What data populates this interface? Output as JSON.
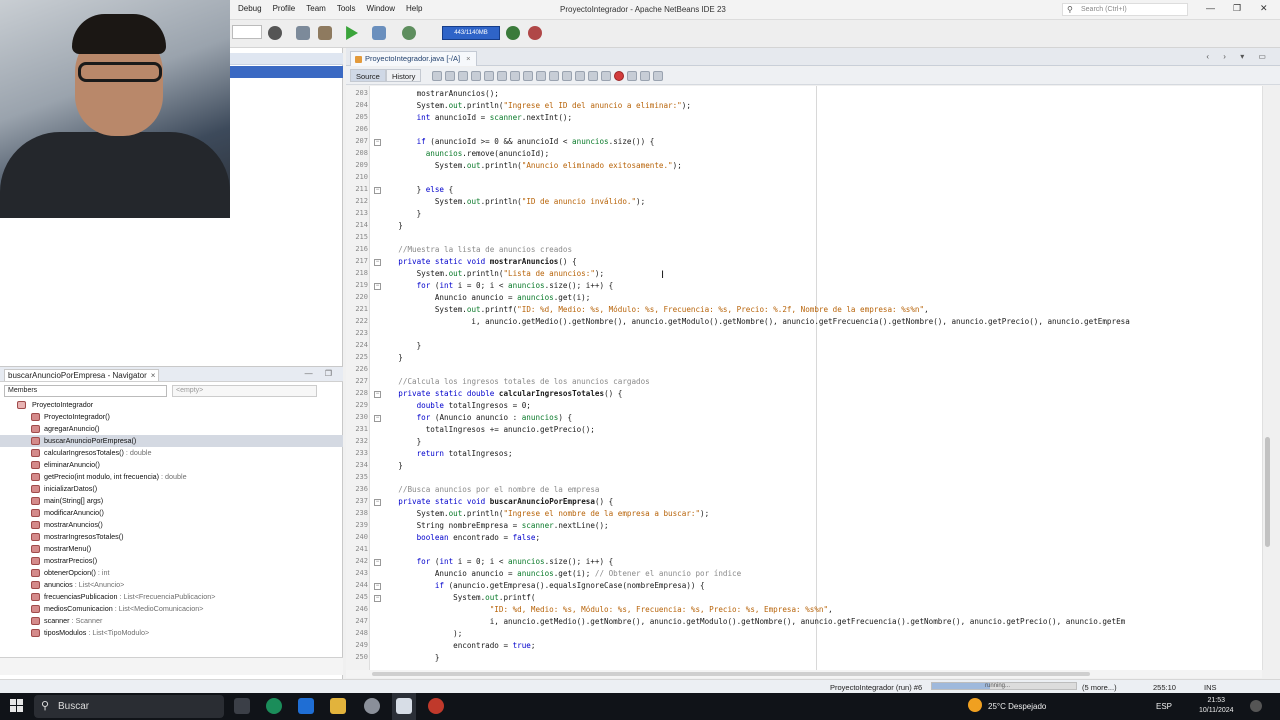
{
  "window": {
    "title": "ProyectoIntegrador - Apache NetBeans IDE 23",
    "search_placeholder": "Search (Ctrl+I)",
    "menu": [
      "Debug",
      "Profile",
      "Team",
      "Tools",
      "Window",
      "Help"
    ],
    "controls": [
      "—",
      "❐",
      "✕"
    ]
  },
  "toolbar": {
    "profile_button": "443/1140MB"
  },
  "editor": {
    "tab_label": "ProyectoIntegrador.java",
    "tab_suffix": "[-/A]",
    "view_source": "Source",
    "view_history": "History"
  },
  "code": {
    "lines": [
      {
        "n": "203",
        "text": "        mostrarAnuncios();"
      },
      {
        "n": "204",
        "text": "        System.out.println(\"Ingrese el ID del anuncio a eliminar:\");"
      },
      {
        "n": "205",
        "text": "        int anuncioId = scanner.nextInt();"
      },
      {
        "n": "206",
        "text": ""
      },
      {
        "n": "207",
        "text": "        if (anuncioId >= 0 && anuncioId < anuncios.size()) {"
      },
      {
        "n": "208",
        "text": "          anuncios.remove(anuncioId);"
      },
      {
        "n": "209",
        "text": "            System.out.println(\"Anuncio eliminado exitosamente.\");"
      },
      {
        "n": "210",
        "text": ""
      },
      {
        "n": "211",
        "text": "        } else {"
      },
      {
        "n": "212",
        "text": "            System.out.println(\"ID de anuncio inválido.\");"
      },
      {
        "n": "213",
        "text": "        }"
      },
      {
        "n": "214",
        "text": "    }"
      },
      {
        "n": "215",
        "text": ""
      },
      {
        "n": "216",
        "text": "    //Muestra la lista de anuncios creados"
      },
      {
        "n": "217",
        "text": "    private static void mostrarAnuncios() {"
      },
      {
        "n": "218",
        "text": "        System.out.println(\"Lista de anuncios:\");"
      },
      {
        "n": "219",
        "text": "        for (int i = 0; i < anuncios.size(); i++) {"
      },
      {
        "n": "220",
        "text": "            Anuncio anuncio = anuncios.get(i);"
      },
      {
        "n": "221",
        "text": "            System.out.printf(\"ID: %d, Medio: %s, Módulo: %s, Frecuencia: %s, Precio: %.2f, Nombre de la empresa: %s%n\","
      },
      {
        "n": "222",
        "text": "                    i, anuncio.getMedio().getNombre(), anuncio.getModulo().getNombre(), anuncio.getFrecuencia().getNombre(), anuncio.getPrecio(), anuncio.getEmpresa"
      },
      {
        "n": "223",
        "text": ""
      },
      {
        "n": "224",
        "text": "        }"
      },
      {
        "n": "225",
        "text": "    }"
      },
      {
        "n": "226",
        "text": ""
      },
      {
        "n": "227",
        "text": "    //Calcula los ingresos totales de los anuncios cargados"
      },
      {
        "n": "228",
        "text": "    private static double calcularIngresosTotales() {"
      },
      {
        "n": "229",
        "text": "        double totalIngresos = 0;"
      },
      {
        "n": "230",
        "text": "        for (Anuncio anuncio : anuncios) {"
      },
      {
        "n": "231",
        "text": "          totalIngresos += anuncio.getPrecio();"
      },
      {
        "n": "232",
        "text": "        }"
      },
      {
        "n": "233",
        "text": "        return totalIngresos;"
      },
      {
        "n": "234",
        "text": "    }"
      },
      {
        "n": "235",
        "text": ""
      },
      {
        "n": "236",
        "text": "    //Busca anuncios por el nombre de la empresa"
      },
      {
        "n": "237",
        "text": "    private static void buscarAnuncioPorEmpresa() {"
      },
      {
        "n": "238",
        "text": "        System.out.println(\"Ingrese el nombre de la empresa a buscar:\");"
      },
      {
        "n": "239",
        "text": "        String nombreEmpresa = scanner.nextLine();"
      },
      {
        "n": "240",
        "text": "        boolean encontrado = false;"
      },
      {
        "n": "241",
        "text": ""
      },
      {
        "n": "242",
        "text": "        for (int i = 0; i < anuncios.size(); i++) {"
      },
      {
        "n": "243",
        "text": "            Anuncio anuncio = anuncios.get(i); // Obtener el anuncio por índice"
      },
      {
        "n": "244",
        "text": "            if (anuncio.getEmpresa().equalsIgnoreCase(nombreEmpresa)) {"
      },
      {
        "n": "245",
        "text": "                System.out.printf("
      },
      {
        "n": "246",
        "text": "                        \"ID: %d, Medio: %s, Módulo: %s, Frecuencia: %s, Precio: %s, Empresa: %s%n\","
      },
      {
        "n": "247",
        "text": "                        i, anuncio.getMedio().getNombre(), anuncio.getModulo().getNombre(), anuncio.getFrecuencia().getNombre(), anuncio.getPrecio(), anuncio.getEm"
      },
      {
        "n": "248",
        "text": "                );"
      },
      {
        "n": "249",
        "text": "                encontrado = true;"
      },
      {
        "n": "250",
        "text": "            }"
      }
    ]
  },
  "navigator": {
    "title": "buscarAnuncioPorEmpresa - Navigator",
    "filter": "Members",
    "filter2": "<empty>",
    "items": [
      {
        "label": "ProyectoIntegrador",
        "type": "",
        "root": true,
        "selected": false
      },
      {
        "label": "ProyectoIntegrador()",
        "type": "",
        "root": false,
        "selected": false
      },
      {
        "label": "agregarAnuncio()",
        "type": "",
        "root": false,
        "selected": false
      },
      {
        "label": "buscarAnuncioPorEmpresa()",
        "type": "",
        "root": false,
        "selected": true
      },
      {
        "label": "calcularIngresosTotales()",
        "type": " : double",
        "root": false,
        "selected": false
      },
      {
        "label": "eliminarAnuncio()",
        "type": "",
        "root": false,
        "selected": false
      },
      {
        "label": "getPrecio(int modulo, int frecuencia)",
        "type": " : double",
        "root": false,
        "selected": false
      },
      {
        "label": "inicializarDatos()",
        "type": "",
        "root": false,
        "selected": false
      },
      {
        "label": "main(String[] args)",
        "type": "",
        "root": false,
        "selected": false
      },
      {
        "label": "modificarAnuncio()",
        "type": "",
        "root": false,
        "selected": false
      },
      {
        "label": "mostrarAnuncios()",
        "type": "",
        "root": false,
        "selected": false
      },
      {
        "label": "mostrarIngresosTotales()",
        "type": "",
        "root": false,
        "selected": false
      },
      {
        "label": "mostrarMenu()",
        "type": "",
        "root": false,
        "selected": false
      },
      {
        "label": "mostrarPrecios()",
        "type": "",
        "root": false,
        "selected": false
      },
      {
        "label": "obtenerOpcion()",
        "type": " : int",
        "root": false,
        "selected": false
      },
      {
        "label": "anuncios",
        "type": " : List<Anuncio>",
        "root": false,
        "selected": false
      },
      {
        "label": "frecuenciasPublicacion",
        "type": " : List<FrecuenciaPublicacion>",
        "root": false,
        "selected": false
      },
      {
        "label": "mediosComunicacion",
        "type": " : List<MedioComunicacion>",
        "root": false,
        "selected": false
      },
      {
        "label": "scanner",
        "type": " : Scanner",
        "root": false,
        "selected": false
      },
      {
        "label": "tiposModulos",
        "type": " : List<TipoModulo>",
        "root": false,
        "selected": false
      }
    ]
  },
  "status": {
    "run_task": "ProyectoIntegrador (run) #6",
    "progress_label": "running...",
    "progress": 0.4,
    "more": "(5 more...)",
    "position": "255:10",
    "mode": "INS"
  },
  "taskbar": {
    "search": "Buscar",
    "weather": "25°C  Despejado",
    "lang": "ESP",
    "time": "21:53",
    "date": "10/11/2024"
  },
  "colors": {
    "keyword": "#0000cc",
    "string": "#b8640a",
    "field": "#0a7a2a",
    "comment": "#8a8a8a"
  }
}
